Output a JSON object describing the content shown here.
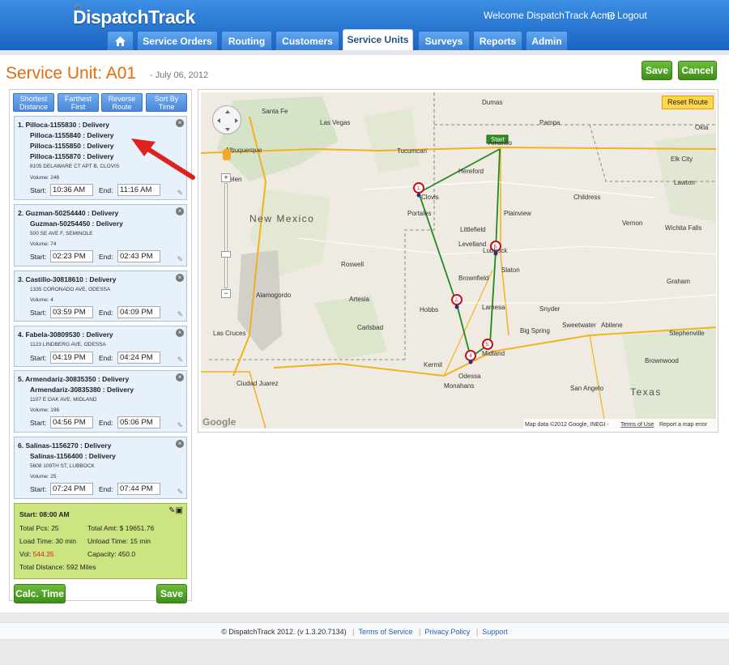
{
  "header": {
    "logo": "DispatchTrack",
    "welcome": "Welcome DispatchTrack Acme",
    "logout": "Logout",
    "tabs": [
      {
        "label": "Service Orders"
      },
      {
        "label": "Routing"
      },
      {
        "label": "Customers"
      },
      {
        "label": "Service Units"
      },
      {
        "label": "Surveys"
      },
      {
        "label": "Reports"
      },
      {
        "label": "Admin"
      }
    ]
  },
  "page": {
    "title": "Service Unit: A01",
    "date": "- July 06, 2012",
    "save_label": "Save",
    "cancel_label": "Cancel"
  },
  "sort_buttons": [
    {
      "line1": "Shortest",
      "line2": "Distance"
    },
    {
      "line1": "Farthest",
      "line2": "First"
    },
    {
      "line1": "Reverse",
      "line2": "Route"
    },
    {
      "line1": "Sort By",
      "line2": "Time"
    }
  ],
  "stops": [
    {
      "orders": [
        "1.   Pilloca-1155830 : Delivery",
        "Pilloca-1155840 : Delivery",
        "Pilloca-1155850 : Delivery",
        "Pilloca-1155870 : Delivery"
      ],
      "address": "8105 DELAWARE CT APT B, CLOVIS",
      "volume": "Volume: 246",
      "start": "10:36 AM",
      "end": "11:16 AM"
    },
    {
      "orders": [
        "2.   Guzman-50254440 : Delivery",
        "Guzman-50254450 : Delivery"
      ],
      "address": "500 SE AVE F, SEMINOLE",
      "volume": "Volume: 74",
      "start": "02:23 PM",
      "end": "02:43 PM"
    },
    {
      "orders": [
        "3.   Castillo-30818610 : Delivery"
      ],
      "address": "1335 CORONADO AVE, ODESSA",
      "volume": "Volume: 4",
      "start": "03:59 PM",
      "end": "04:09 PM"
    },
    {
      "orders": [
        "4.   Fabela-30809530 : Delivery"
      ],
      "address": "1123 LINDBERG AVE, ODESSA",
      "volume": "",
      "start": "04:19 PM",
      "end": "04:24 PM"
    },
    {
      "orders": [
        "5.   Armendariz-30835350 : Delivery",
        "Armendariz-30835380 : Delivery"
      ],
      "address": "1107 E OAK AVE, MIDLAND",
      "volume": "Volume: 196",
      "start": "04:56 PM",
      "end": "05:06 PM"
    },
    {
      "orders": [
        "6.   Salinas-1156270 : Delivery",
        "Salinas-1156400 : Delivery"
      ],
      "address": "5608 109TH ST, LUBBOCK",
      "volume": "Volume: 25",
      "start": "07:24 PM",
      "end": "07:44 PM"
    }
  ],
  "labels": {
    "start": "Start:",
    "end": "End:"
  },
  "summary": {
    "start": "Start: 08:00 AM",
    "total_pcs": "Total Pcs: 25",
    "total_amt": "Total Amt: $ 19651.76",
    "load_time": "Load Time: 30 min",
    "unload_time": "Unload Time: 15 min",
    "vol_label": "Vol:",
    "vol_value": "544.35",
    "capacity": "Capacity: 450.0",
    "total_distance": "Total Distance: 592 Miles"
  },
  "calc_time_label": "Calc. Time",
  "save_bottom_label": "Save",
  "map": {
    "reset_route": "Reset Route",
    "attribution": "Map data ©2012 Google, INEGI -",
    "terms": "Terms of Use",
    "report_error": "Report a map error",
    "google": "Google",
    "start_marker": "Start",
    "places": [
      {
        "name": "Santa Fe"
      },
      {
        "name": "Las Vegas"
      },
      {
        "name": "Dumas"
      },
      {
        "name": "Pampa"
      },
      {
        "name": "Okla"
      },
      {
        "name": "Albuquerque"
      },
      {
        "name": "Tucumcari"
      },
      {
        "name": "Amarillo"
      },
      {
        "name": "Elk City"
      },
      {
        "name": "Belen"
      },
      {
        "name": "Hereford"
      },
      {
        "name": "Clovis"
      },
      {
        "name": "Lawton"
      },
      {
        "name": "Childress"
      },
      {
        "name": "Portales"
      },
      {
        "name": "Plainview"
      },
      {
        "name": "Vernon"
      },
      {
        "name": "Littlefield"
      },
      {
        "name": "Wichita Falls"
      },
      {
        "name": "Levelland"
      },
      {
        "name": "Lubbock"
      },
      {
        "name": "Roswell"
      },
      {
        "name": "Brownfield"
      },
      {
        "name": "Slaton"
      },
      {
        "name": "Graham"
      },
      {
        "name": "Alamogordo"
      },
      {
        "name": "Artesia"
      },
      {
        "name": "Hobbs"
      },
      {
        "name": "Lamesa"
      },
      {
        "name": "Snyder"
      },
      {
        "name": "Sweetwater"
      },
      {
        "name": "Abilene"
      },
      {
        "name": "Carlsbad"
      },
      {
        "name": "Big Spring"
      },
      {
        "name": "Las Cruces"
      },
      {
        "name": "Midland"
      },
      {
        "name": "Stephenville"
      },
      {
        "name": "Kermit"
      },
      {
        "name": "Odessa"
      },
      {
        "name": "Brownwood"
      },
      {
        "name": "Ciudad Juarez"
      },
      {
        "name": "Monahans"
      },
      {
        "name": "San Angelo"
      },
      {
        "name": "New Mexico"
      },
      {
        "name": "Texas"
      }
    ]
  },
  "footer": {
    "copyright": "© DispatchTrack 2012. (v 1.3.20.7134)",
    "terms": "Terms of Service",
    "privacy": "Privacy Policy",
    "support": "Support"
  },
  "colors": {
    "header_blue": "#2370d0",
    "title_orange": "#e46c0a",
    "button_green": "#4f9f24",
    "summary_green": "#cde580",
    "route_green": "#1f8a1f"
  }
}
